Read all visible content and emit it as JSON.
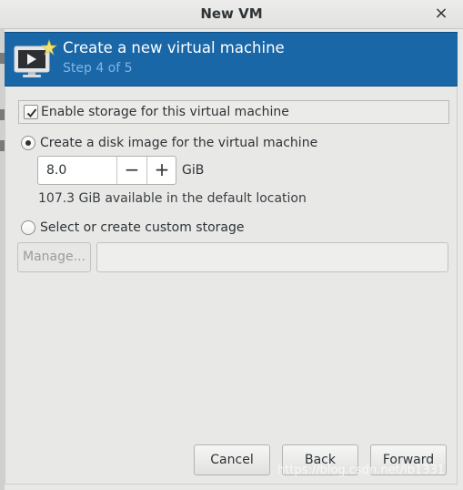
{
  "window": {
    "title": "New VM",
    "close_glyph": "×"
  },
  "header": {
    "title": "Create a new virtual machine",
    "step": "Step 4 of 5",
    "icon": "monitor-with-star-icon",
    "background": "#1a67a8"
  },
  "storage": {
    "enable_label": "Enable storage for this virtual machine",
    "enable_checked": true,
    "disk_image_label": "Create a disk image for the virtual machine",
    "disk_image_selected": true,
    "size_value": "8.0",
    "size_unit": "GiB",
    "decrement": "−",
    "increment": "+",
    "available_text": "107.3 GiB available in the default location",
    "custom_label": "Select or create custom storage",
    "custom_selected": false,
    "manage_label": "Manage...",
    "custom_path": ""
  },
  "buttons": {
    "cancel": "Cancel",
    "back": "Back",
    "forward": "Forward"
  },
  "watermark": "https://blog.csdn.net/lb1331"
}
